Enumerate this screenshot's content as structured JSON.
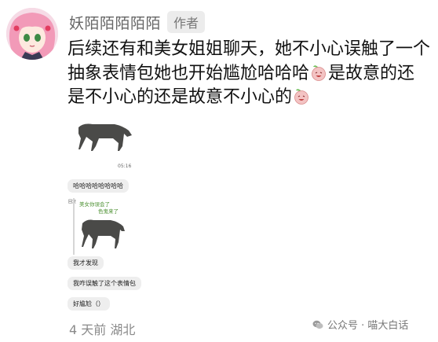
{
  "author": {
    "name": "妖陌陌陌陌陌",
    "tag": "作者"
  },
  "comment": {
    "seg1": "后续还有和美女姐姐聊天，她不小心误触了一个抽象表情包她也开始尴尬哈哈哈",
    "seg2": "是故意的还是不小心的还是故意不小心的",
    "emoji_icon": "peach-face-emoji-icon"
  },
  "screenshot": {
    "time": "05:16",
    "msg_ha": "哈哈哈哈哈哈哈哈",
    "quote_label": "回复",
    "quote_line1": "美女你误会了",
    "quote_line2": "色鬼来了",
    "msg_discover": "我才发现",
    "msg_sent": "我咋误触了这个表情包",
    "msg_awkward": "好尴尬（）"
  },
  "footer": {
    "meta": "4 天前 湖北"
  },
  "watermark": {
    "text": "公众号 · 喵大白话",
    "icon": "wechat-icon"
  },
  "colors": {
    "emoji_bg": "#f3c3c3",
    "quote_green": "#4a8f2f"
  }
}
